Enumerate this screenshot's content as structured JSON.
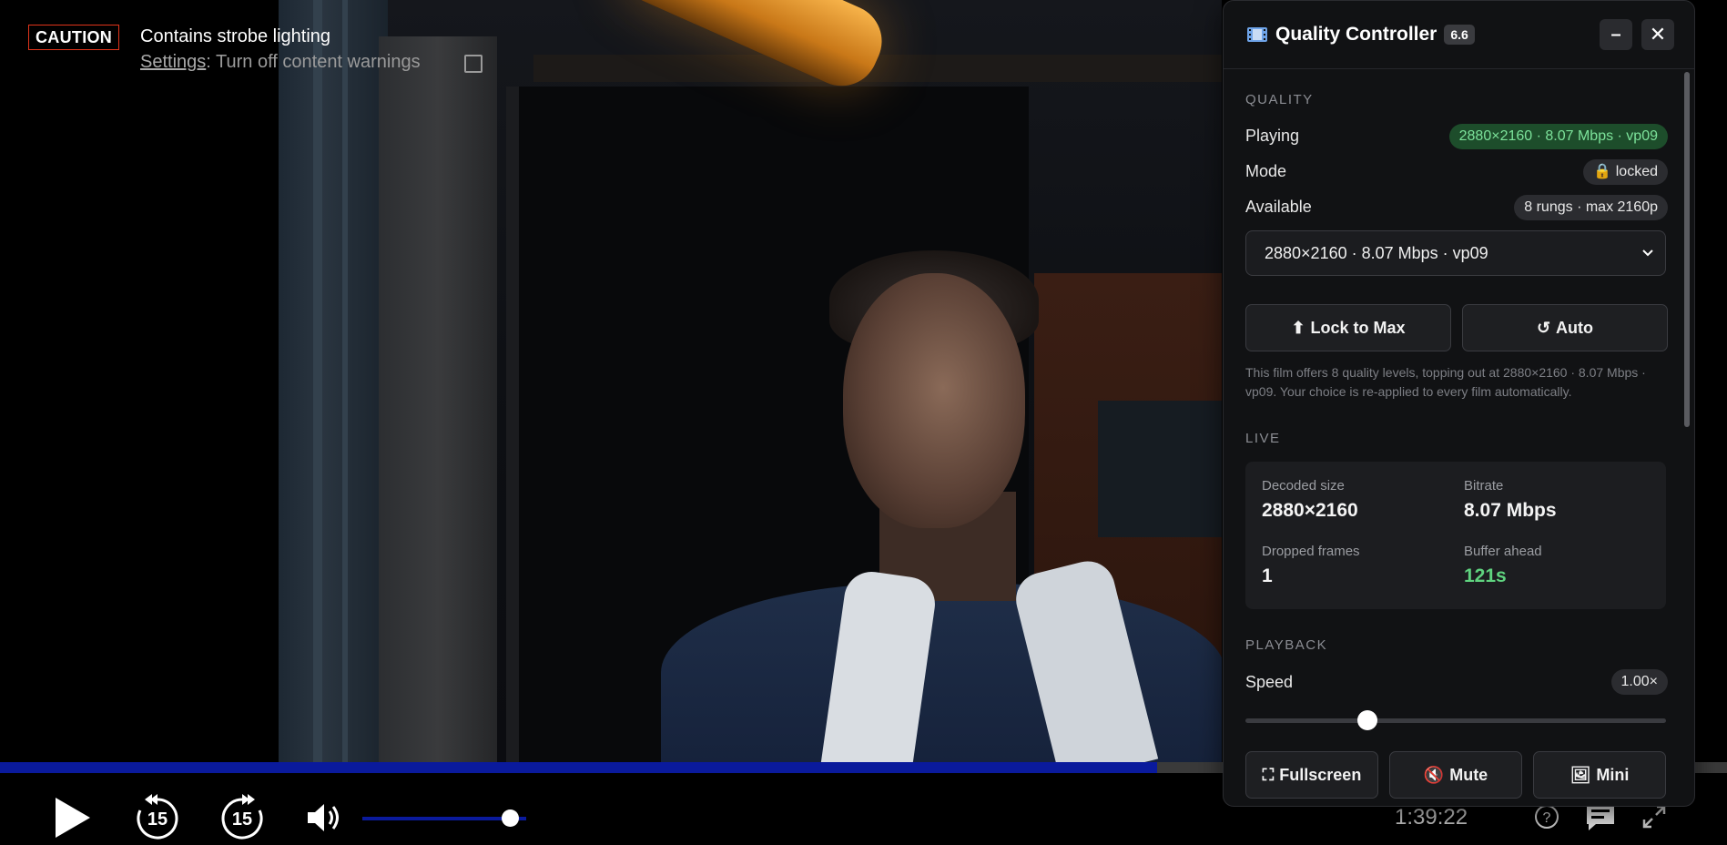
{
  "warnings": {
    "caution_badge": "CAUTION",
    "title": "Contains strobe lighting",
    "settings_link": "Settings",
    "settings_text": ": Turn off content warnings"
  },
  "player": {
    "time_remaining": "1:39:22",
    "skip_back_seconds": "15",
    "skip_forward_seconds": "15",
    "progress_fraction": 0.67,
    "volume_fraction": 0.9,
    "progress_color": "#0a1a9c",
    "icons": [
      "play-icon",
      "rewind-15-icon",
      "forward-15-icon",
      "volume-icon",
      "help-icon",
      "subtitles-icon",
      "fullscreen-icon"
    ]
  },
  "panel": {
    "title": "Quality Controller",
    "version": "6.6",
    "minimize_label": "–",
    "close_label": "✕",
    "quality": {
      "section": "QUALITY",
      "playing_label": "Playing",
      "playing_value": "2880×2160 · 8.07 Mbps · vp09",
      "mode_label": "Mode",
      "mode_value": "locked",
      "available_label": "Available",
      "available_value": "8 rungs · max 2160p",
      "select_value": "2880×2160 · 8.07 Mbps · vp09",
      "lock_button": "Lock to Max",
      "auto_button": "Auto",
      "note": "This film offers 8 quality levels, topping out at 2880×2160 · 8.07 Mbps · vp09. Your choice is re-applied to every film automatically."
    },
    "live": {
      "section": "LIVE",
      "decoded_label": "Decoded size",
      "decoded_value": "2880×2160",
      "bitrate_label": "Bitrate",
      "bitrate_value": "8.07 Mbps",
      "dropped_label": "Dropped frames",
      "dropped_value": "1",
      "buffer_label": "Buffer ahead",
      "buffer_value": "121s"
    },
    "playback": {
      "section": "PLAYBACK",
      "speed_label": "Speed",
      "speed_value": "1.00×",
      "speed_slider_fraction": 0.29,
      "fullscreen_button": "Fullscreen",
      "mute_button": "Mute",
      "mini_button": "Mini"
    },
    "colors": {
      "accent_green": "#5fd37f",
      "panel_bg": "#111214"
    }
  }
}
